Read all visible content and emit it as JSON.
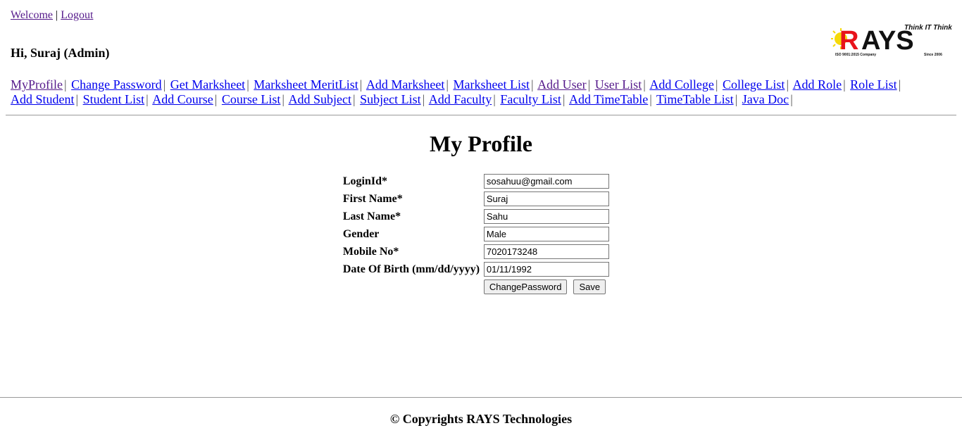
{
  "header": {
    "welcome_label": "Welcome",
    "separator": "|",
    "logout_label": "Logout",
    "greeting": "Hi, Suraj (Admin)"
  },
  "logo": {
    "brand": "RAYS",
    "tagline": "Think IT Think Us",
    "iso": "ISO 9001:2015 Company",
    "since": "Since 2006",
    "colors": {
      "red": "#e8131b",
      "black": "#111111",
      "sun": "#f5d90a"
    }
  },
  "nav": {
    "items": [
      {
        "label": "MyProfile",
        "visited": true
      },
      {
        "label": "Change Password",
        "visited": false
      },
      {
        "label": "Get Marksheet",
        "visited": false
      },
      {
        "label": "Marksheet MeritList",
        "visited": false
      },
      {
        "label": "Add Marksheet",
        "visited": false
      },
      {
        "label": "Marksheet List",
        "visited": false
      },
      {
        "label": "Add User",
        "visited": true
      },
      {
        "label": "User List",
        "visited": true
      },
      {
        "label": "Add College",
        "visited": false
      },
      {
        "label": "College List",
        "visited": false
      },
      {
        "label": "Add Role",
        "visited": false
      },
      {
        "label": "Role List",
        "visited": false
      },
      {
        "label": "Add Student",
        "visited": false
      },
      {
        "label": "Student List",
        "visited": false
      },
      {
        "label": "Add Course",
        "visited": false
      },
      {
        "label": "Course List",
        "visited": false
      },
      {
        "label": "Add Subject",
        "visited": false
      },
      {
        "label": "Subject List",
        "visited": false
      },
      {
        "label": "Add Faculty",
        "visited": false
      },
      {
        "label": "Faculty List",
        "visited": false
      },
      {
        "label": "Add TimeTable",
        "visited": false
      },
      {
        "label": "TimeTable List",
        "visited": false
      },
      {
        "label": "Java Doc",
        "visited": false
      }
    ]
  },
  "page": {
    "title": "My Profile"
  },
  "form": {
    "login_id": {
      "label": "LoginId*",
      "value": "sosahuu@gmail.com"
    },
    "first_name": {
      "label": "First Name*",
      "value": "Suraj"
    },
    "last_name": {
      "label": "Last Name*",
      "value": "Sahu"
    },
    "gender": {
      "label": "Gender",
      "value": "Male"
    },
    "mobile": {
      "label": "Mobile No*",
      "value": "7020173248"
    },
    "dob": {
      "label": "Date Of Birth (mm/dd/yyyy)",
      "value": "01/11/1992"
    },
    "change_password_button": "ChangePassword",
    "save_button": "Save"
  },
  "footer": {
    "text": "© Copyrights RAYS Technologies"
  }
}
